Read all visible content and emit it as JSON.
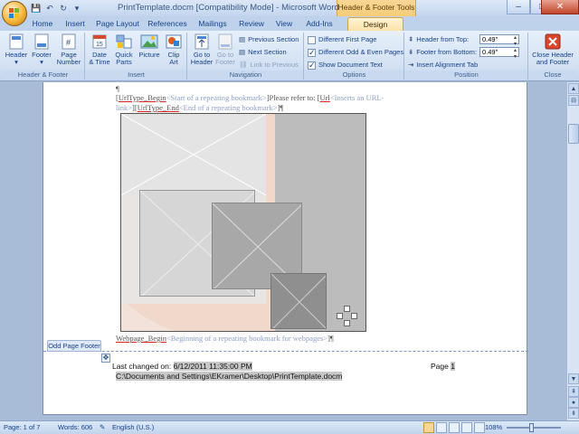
{
  "window": {
    "title": "PrintTemplate.docm [Compatibility Mode] - Microsoft Word",
    "contextual_tab_title": "Header & Footer Tools",
    "minimize": "–",
    "maximize": "□",
    "close": "✕"
  },
  "quick_access": {
    "save": "💾",
    "undo": "↶",
    "redo": "↻",
    "customize": "▾"
  },
  "tabs": [
    {
      "label": "Home"
    },
    {
      "label": "Insert"
    },
    {
      "label": "Page Layout"
    },
    {
      "label": "References"
    },
    {
      "label": "Mailings"
    },
    {
      "label": "Review"
    },
    {
      "label": "View"
    },
    {
      "label": "Add-Ins"
    },
    {
      "label": "Design"
    }
  ],
  "ribbon": {
    "header_footer": {
      "label": "Header & Footer",
      "header": "Header",
      "footer": "Footer",
      "page_number_1": "Page",
      "page_number_2": "Number"
    },
    "insert": {
      "label": "Insert",
      "date_time_1": "Date",
      "date_time_2": "& Time",
      "quick_parts_1": "Quick",
      "quick_parts_2": "Parts",
      "picture": "Picture",
      "clip_art_1": "Clip",
      "clip_art_2": "Art"
    },
    "navigation": {
      "label": "Navigation",
      "go_to_header_1": "Go to",
      "go_to_header_2": "Header",
      "go_to_footer_1": "Go to",
      "go_to_footer_2": "Footer",
      "previous_section": "Previous Section",
      "next_section": "Next Section",
      "link_to_previous": "Link to Previous"
    },
    "options": {
      "label": "Options",
      "different_first_page": "Different First Page",
      "different_first_page_checked": false,
      "different_odd_even": "Different Odd & Even Pages",
      "different_odd_even_checked": true,
      "show_document_text": "Show Document Text",
      "show_document_text_checked": true
    },
    "position": {
      "label": "Position",
      "header_from_top": "Header from Top:",
      "header_from_top_value": "0.49\"",
      "footer_from_bottom": "Footer from Bottom:",
      "footer_from_bottom_value": "0.49\"",
      "insert_alignment_tab": "Insert Alignment Tab"
    },
    "close": {
      "label": "Close",
      "close_1": "Close Header",
      "close_2": "and Footer"
    }
  },
  "document": {
    "line1_a": "UrlType_Begin",
    "line1_b": "<Start of a repeating bookmark>",
    "line1_c": "Please refer to: ",
    "line1_d": "Url",
    "line1_e": "<Inserts an URL-",
    "line2_a": "link>",
    "line2_b": "UrlType_End",
    "line2_c": "<End of a repeating bookmark>",
    "line3_a": "Webpage_Begin",
    "line3_b": "<Beginning of a repeating bookmark for webpages>",
    "footer_tab": "Odd Page Footer",
    "last_changed_label": "Last changed on: ",
    "last_changed_value": "6/12/2011 11:35:00 PM",
    "page_label": "Page ",
    "page_value": "1",
    "file_path": "C:\\Documents and Settings\\EKramer\\Desktop\\PrintTemplate.docm"
  },
  "status": {
    "page": "Page: 1 of 7",
    "words": "Words: 606",
    "language": "English (U.S.)",
    "zoom": "108%"
  }
}
